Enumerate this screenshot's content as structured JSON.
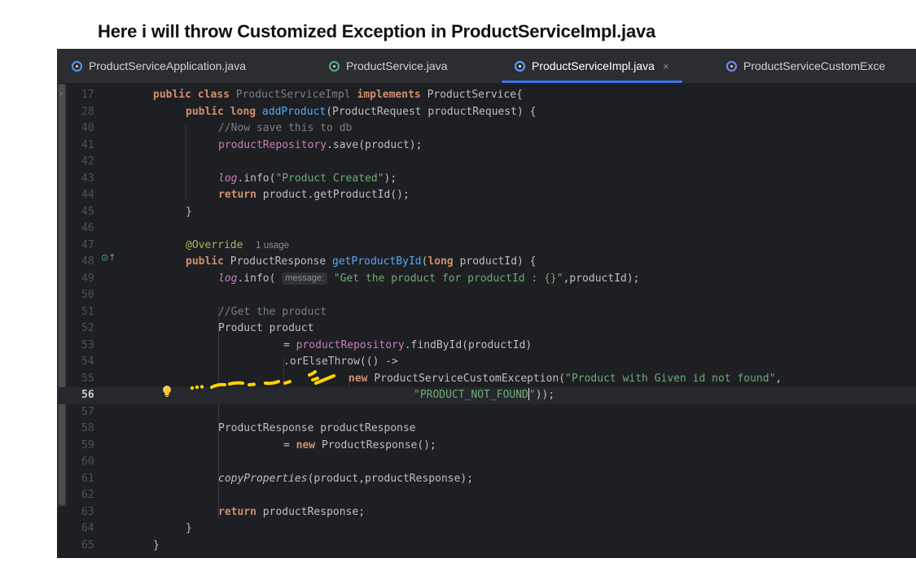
{
  "annotation": {
    "heading": "Here i will throw Customized Exception in ProductServiceImpl.java"
  },
  "tabs": [
    {
      "label": "ProductServiceApplication.java",
      "icon": "spring-app-icon",
      "active": false
    },
    {
      "label": "ProductService.java",
      "icon": "interface-icon",
      "active": false
    },
    {
      "label": "ProductServiceImpl.java",
      "icon": "class-icon",
      "active": true,
      "close": "×"
    },
    {
      "label": "ProductServiceCustomExce",
      "icon": "exception-class-icon",
      "active": false
    }
  ],
  "editor": {
    "current_line": "56",
    "inlay_hint_message": "message:",
    "usage_hint": "1 usage",
    "lines": [
      {
        "n": "17",
        "t1": "public class ",
        "t2": "ProductServiceImpl",
        "t3": " implements ",
        "t4": "ProductService{"
      },
      {
        "n": "28",
        "t1": "public long ",
        "t2": "addProduct",
        "t3": "(ProductRequest productRequest) {"
      },
      {
        "n": "40",
        "t1": "//Now save this to db"
      },
      {
        "n": "41",
        "t1": "productRepository",
        "t2": ".save(product);"
      },
      {
        "n": "42"
      },
      {
        "n": "43",
        "t1": "log",
        "t2": ".info(",
        "t3": "\"Product Created\"",
        "t4": ");"
      },
      {
        "n": "44",
        "t1": "return ",
        "t2": "product.getProductId();"
      },
      {
        "n": "45",
        "t1": "}"
      },
      {
        "n": "46"
      },
      {
        "n": "47",
        "t1": "@Override"
      },
      {
        "n": "48",
        "t1": "public ",
        "t2": "ProductResponse ",
        "t3": "getProductById",
        "t4": "(",
        "t5": "long ",
        "t6": "productId) {"
      },
      {
        "n": "49",
        "t1": "log",
        "t2": ".info( ",
        "t3": "\"Get the product for productId : {}\"",
        "t4": ",productId);"
      },
      {
        "n": "50"
      },
      {
        "n": "51",
        "t1": "//Get the product"
      },
      {
        "n": "52",
        "t1": "Product product"
      },
      {
        "n": "53",
        "t1": "= ",
        "t2": "productRepository",
        "t3": ".findById(productId)"
      },
      {
        "n": "54",
        "t1": ".orElseThrow(() ->"
      },
      {
        "n": "55",
        "t1": "new ",
        "t2": "ProductServiceCustomException(",
        "t3": "\"Product with Given id not found\"",
        "t4": ","
      },
      {
        "n": "56",
        "t1": "\"PRODUCT_NOT_FOUND",
        "t2": "\"",
        "t3": "));"
      },
      {
        "n": "57"
      },
      {
        "n": "58",
        "t1": "ProductResponse productResponse"
      },
      {
        "n": "59",
        "t1": "= ",
        "t2": "new ",
        "t3": "ProductResponse();"
      },
      {
        "n": "60"
      },
      {
        "n": "61",
        "t1": "copyProperties",
        "t2": "(product,productResponse);"
      },
      {
        "n": "62"
      },
      {
        "n": "63",
        "t1": "return ",
        "t2": "productResponse;"
      },
      {
        "n": "64",
        "t1": "}"
      },
      {
        "n": "65",
        "t1": "}"
      }
    ]
  },
  "colors": {
    "editor_bg": "#1e1f22",
    "keyword": "#cf8e6d",
    "function": "#56a8f5",
    "field": "#c77dbb",
    "string": "#6aab73",
    "comment": "#7a7e85",
    "annotation": "#b3ae60",
    "active_tab_underline": "#3574f0",
    "squiggle_marker": "#ffd400"
  }
}
